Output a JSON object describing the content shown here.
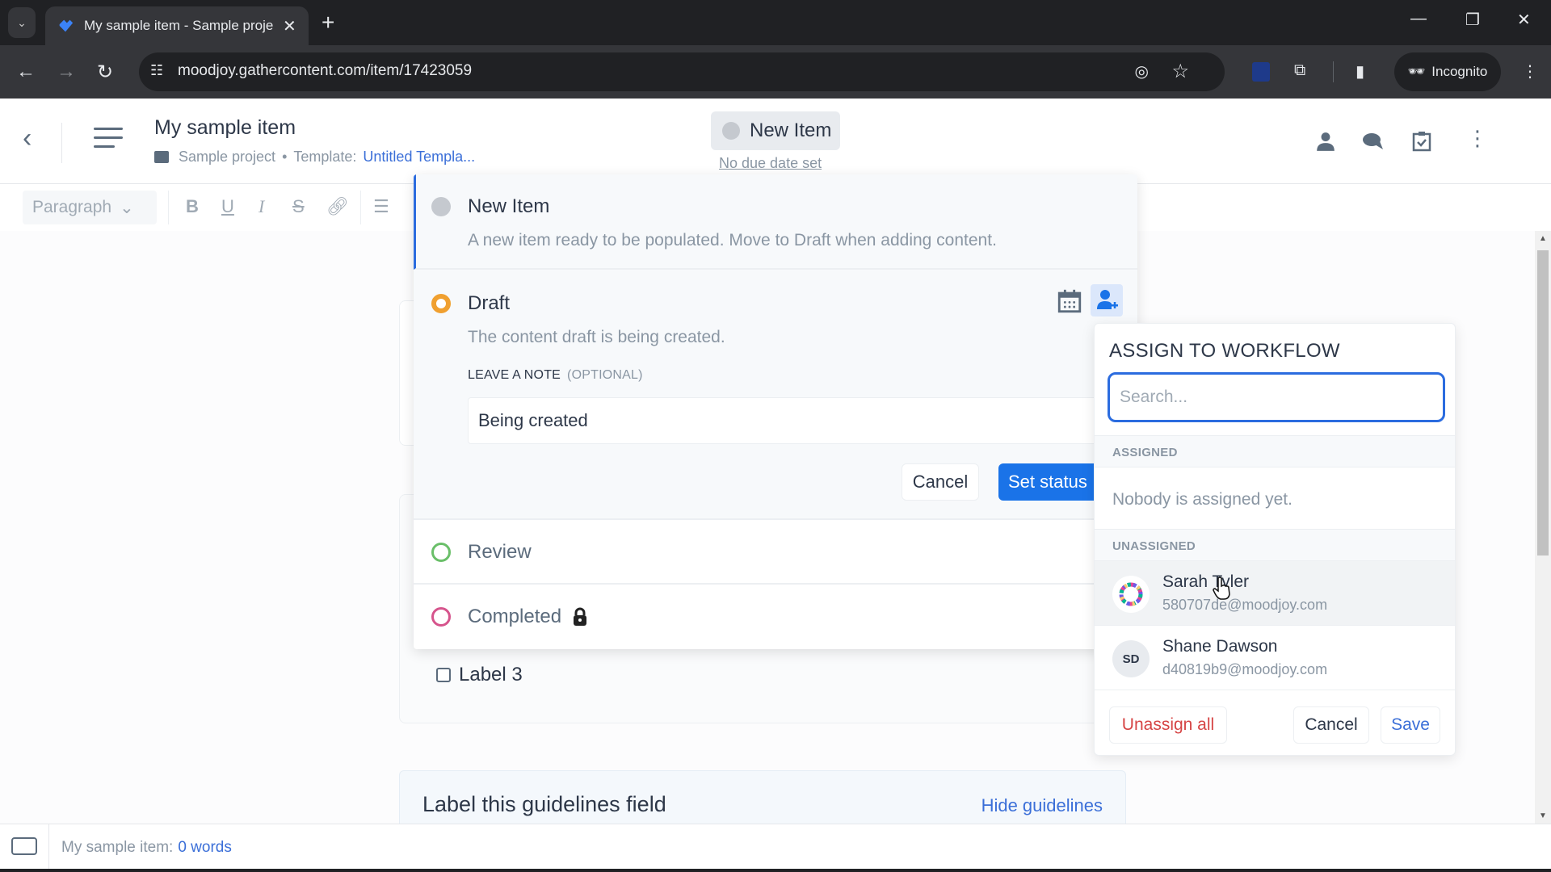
{
  "browser": {
    "tab_title": "My sample item - Sample proje",
    "url": "moodjoy.gathercontent.com/item/17423059",
    "incognito_label": "Incognito"
  },
  "header": {
    "item_title": "My sample item",
    "project": "Sample project",
    "separator": "•",
    "template_label": "Template:",
    "template_name": "Untitled Templa...",
    "status": "New Item",
    "due_date": "No due date set"
  },
  "editor_toolbar": {
    "paragraph_select": "Paragraph",
    "bold": "B",
    "underline": "U",
    "italic": "I",
    "strike": "S"
  },
  "status_dropdown": {
    "statuses": [
      {
        "name": "New Item",
        "description": "A new item ready to be populated. Move to Draft when adding content.",
        "color": "#c5c9cf"
      },
      {
        "name": "Draft",
        "description": "The content draft is being created.",
        "color": "#f0a030"
      },
      {
        "name": "Review",
        "color": "#6abf69"
      },
      {
        "name": "Completed",
        "color": "#d6548c",
        "locked": true
      }
    ],
    "note_label": "LEAVE A NOTE",
    "note_optional": "(OPTIONAL)",
    "note_value": "Being created",
    "cancel_label": "Cancel",
    "set_status_label": "Set status"
  },
  "assign_popup": {
    "title": "ASSIGN TO WORKFLOW",
    "search_placeholder": "Search...",
    "assigned_heading": "ASSIGNED",
    "nobody_text": "Nobody is assigned yet.",
    "unassigned_heading": "UNASSIGNED",
    "users": [
      {
        "name": "Sarah Tyler",
        "email": "580707de@moodjoy.com",
        "initials": ""
      },
      {
        "name": "Shane Dawson",
        "email": "d40819b9@moodjoy.com",
        "initials": "SD"
      }
    ],
    "unassign_all_label": "Unassign all",
    "cancel_label": "Cancel",
    "save_label": "Save"
  },
  "content": {
    "checkbox_label": "Label 3",
    "guidelines_title": "Label this guidelines field",
    "hide_guidelines": "Hide guidelines"
  },
  "footer": {
    "item_name": "My sample item:",
    "word_count": "0 words"
  },
  "colors": {
    "accent": "#1a73e8",
    "danger": "#d64545",
    "link": "#3b6fd8"
  }
}
